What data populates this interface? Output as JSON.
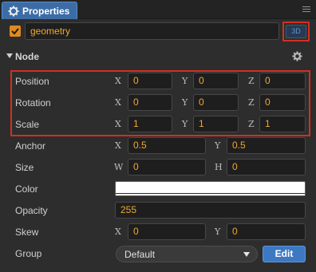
{
  "tab": {
    "title": "Properties",
    "icon": "gear-icon"
  },
  "node": {
    "enabled": true,
    "name": "geometry",
    "mode_button": "3D"
  },
  "section": {
    "title": "Node"
  },
  "position": {
    "label": "Position",
    "x_axis": "X",
    "x": "0",
    "y_axis": "Y",
    "y": "0",
    "z_axis": "Z",
    "z": "0"
  },
  "rotation": {
    "label": "Rotation",
    "x_axis": "X",
    "x": "0",
    "y_axis": "Y",
    "y": "0",
    "z_axis": "Z",
    "z": "0"
  },
  "scale": {
    "label": "Scale",
    "x_axis": "X",
    "x": "1",
    "y_axis": "Y",
    "y": "1",
    "z_axis": "Z",
    "z": "1"
  },
  "anchor": {
    "label": "Anchor",
    "x_axis": "X",
    "x": "0.5",
    "y_axis": "Y",
    "y": "0.5"
  },
  "size": {
    "label": "Size",
    "w_axis": "W",
    "w": "0",
    "h_axis": "H",
    "h": "0"
  },
  "color": {
    "label": "Color",
    "value": "#FFFFFF"
  },
  "opacity": {
    "label": "Opacity",
    "value": "255"
  },
  "skew": {
    "label": "Skew",
    "x_axis": "X",
    "x": "0",
    "y_axis": "Y",
    "y": "0"
  },
  "group": {
    "label": "Group",
    "selected": "Default",
    "edit_label": "Edit"
  }
}
